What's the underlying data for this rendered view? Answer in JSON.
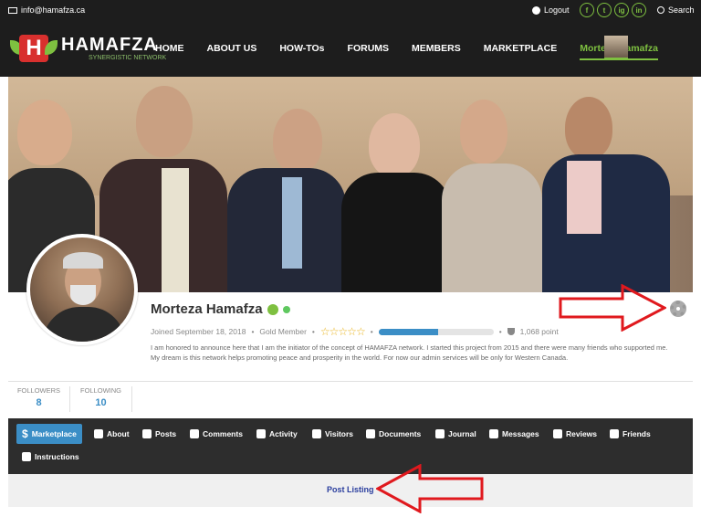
{
  "topbar": {
    "email": "info@hamafza.ca",
    "logout": "Logout",
    "search": "Search",
    "socials": [
      "f",
      "t",
      "ig",
      "in"
    ]
  },
  "brand": {
    "name": "HAMAFZA",
    "tagline": "SYNERGISTIC NETWORK"
  },
  "nav": {
    "items": [
      "HOME",
      "ABOUT US",
      "HOW-TOs",
      "FORUMS",
      "MEMBERS",
      "MARKETPLACE"
    ],
    "active_user": "Morteza Hamafza"
  },
  "profile": {
    "name": "Morteza Hamafza",
    "joined": "Joined September 18, 2018",
    "level": "Gold Member",
    "stars": "☆☆☆☆☆",
    "progress": 0.52,
    "points": "1,068 point",
    "bio": "I am honored to announce here that I am the initiator of the concept of HAMAFZA network. I started this project from 2015 and there were many friends who supported me. My dream is this network helps promoting peace and prosperity in the world. For now our admin services will be only for Western Canada."
  },
  "stats": {
    "followers_label": "FOLLOWERS",
    "followers": "8",
    "following_label": "FOLLOWING",
    "following": "10"
  },
  "tabs": [
    {
      "label": "Marketplace",
      "icon": "dollar-icon"
    },
    {
      "label": "About",
      "icon": "user-icon"
    },
    {
      "label": "Posts",
      "icon": "pencil-icon"
    },
    {
      "label": "Comments",
      "icon": "comment-icon"
    },
    {
      "label": "Activity",
      "icon": "edit-icon"
    },
    {
      "label": "Visitors",
      "icon": "eye-icon"
    },
    {
      "label": "Documents",
      "icon": "file-icon"
    },
    {
      "label": "Journal",
      "icon": "book-icon"
    },
    {
      "label": "Messages",
      "icon": "envelope-icon"
    },
    {
      "label": "Reviews",
      "icon": "star-icon"
    },
    {
      "label": "Friends",
      "icon": "users-icon"
    },
    {
      "label": "Instructions",
      "icon": "tag-icon"
    }
  ],
  "post_listing": "Post Listing",
  "colors": {
    "accent_green": "#7ec040",
    "accent_blue": "#3b8ec6",
    "dark_bg": "#1d1d1d",
    "annotation_red": "#e0191e"
  }
}
